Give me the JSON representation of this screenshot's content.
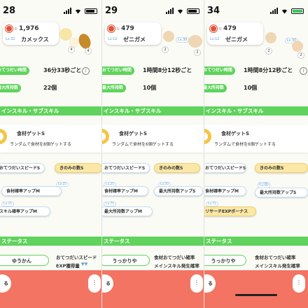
{
  "panels": [
    {
      "time": "28",
      "battery_color": "#111111",
      "cp_label": "ゆ",
      "cp_value": "1,976",
      "level": "Lv.32",
      "pokemon_name": "カメックス",
      "mon_level": "",
      "help_time_label": "おてつだい時間",
      "help_time_value": "36分33秒ごと",
      "max_carry_label": "最大所持数",
      "max_carry_value": "22個",
      "section_skill": "インスキル・サブスキル",
      "skill_name": "食材ゲットS",
      "skill_desc": "ランダムで食材を8個ゲットする",
      "subskills": [
        {
          "label": "おてつだいスピードS",
          "level": ""
        },
        {
          "label": "きのみの数S",
          "level": ""
        },
        {
          "label": "食材確率アップM",
          "level": "Lv.25"
        },
        {
          "label": "スキル確率アップM",
          "level": ""
        }
      ],
      "lv_mark_75": "Lv.75",
      "section_status": "ステータス",
      "nature": "ゆうかん",
      "nature_up": "おてつだいスピード",
      "nature_down": "EXP獲得量",
      "close_label": "る",
      "menu_label": "⋮"
    },
    {
      "time": "29",
      "battery_color": "#111111",
      "cp_label": "ゆ",
      "cp_value": "479",
      "level": "Lv.12",
      "pokemon_name": "ゼニガメ",
      "mon_level": "Lv.30",
      "help_time_label": "おてつだい時間",
      "help_time_value": "1時間8分12秒ごと",
      "max_carry_label": "最大所持数",
      "max_carry_value": "10個",
      "section_skill": "インスキル・サブスキル",
      "skill_name": "食材ゲットS",
      "skill_desc": "ランダムで食材を6個ゲットする",
      "subskills": [
        {
          "label": "おてつだいスピードS",
          "level": ""
        },
        {
          "label": "きのみの数S",
          "level": ""
        },
        {
          "label": "食材確率アップM",
          "level": "Lv.25"
        },
        {
          "label": "最大所持数アップS",
          "level": "Lv.50"
        },
        {
          "label": "最大所持数アップM",
          "level": "Lv.75"
        }
      ],
      "section_status": "ステータス",
      "nature": "うっかりや",
      "nature_up": "食材おてつだい確率",
      "nature_down": "メインスキル発生確率",
      "close_label": "る",
      "menu_label": "⋮"
    },
    {
      "time": "34",
      "battery_color": "#34c759",
      "cp_label": "ゆ",
      "cp_value": "479",
      "level": "Lv.12",
      "pokemon_name": "ゼニガメ",
      "mon_level": "Lv.30",
      "help_time_label": "おてつだい時間",
      "help_time_value": "1時間8分12秒ごと",
      "max_carry_label": "最大所持数",
      "max_carry_value": "10個",
      "section_skill": "インスキル・サブスキル",
      "skill_name": "食材ゲットS",
      "skill_desc": "ランダムで食材を6個ゲットする",
      "subskills": [
        {
          "label": "おてつだいスピードS",
          "level": ""
        },
        {
          "label": "きのみの数S",
          "level": ""
        },
        {
          "label": "食材確率アップM",
          "level": "Lv.25"
        },
        {
          "label": "最大所持数アップS",
          "level": "Lv.50"
        },
        {
          "label": "リサーチEXPボーナス",
          "level": "Lv.75"
        }
      ],
      "section_status": "ステータス",
      "nature": "うっかりや",
      "nature_up": "食材おてつだい確率",
      "nature_down": "メインスキル発生確率",
      "close_label": "る",
      "menu_label": "⋮"
    }
  ]
}
